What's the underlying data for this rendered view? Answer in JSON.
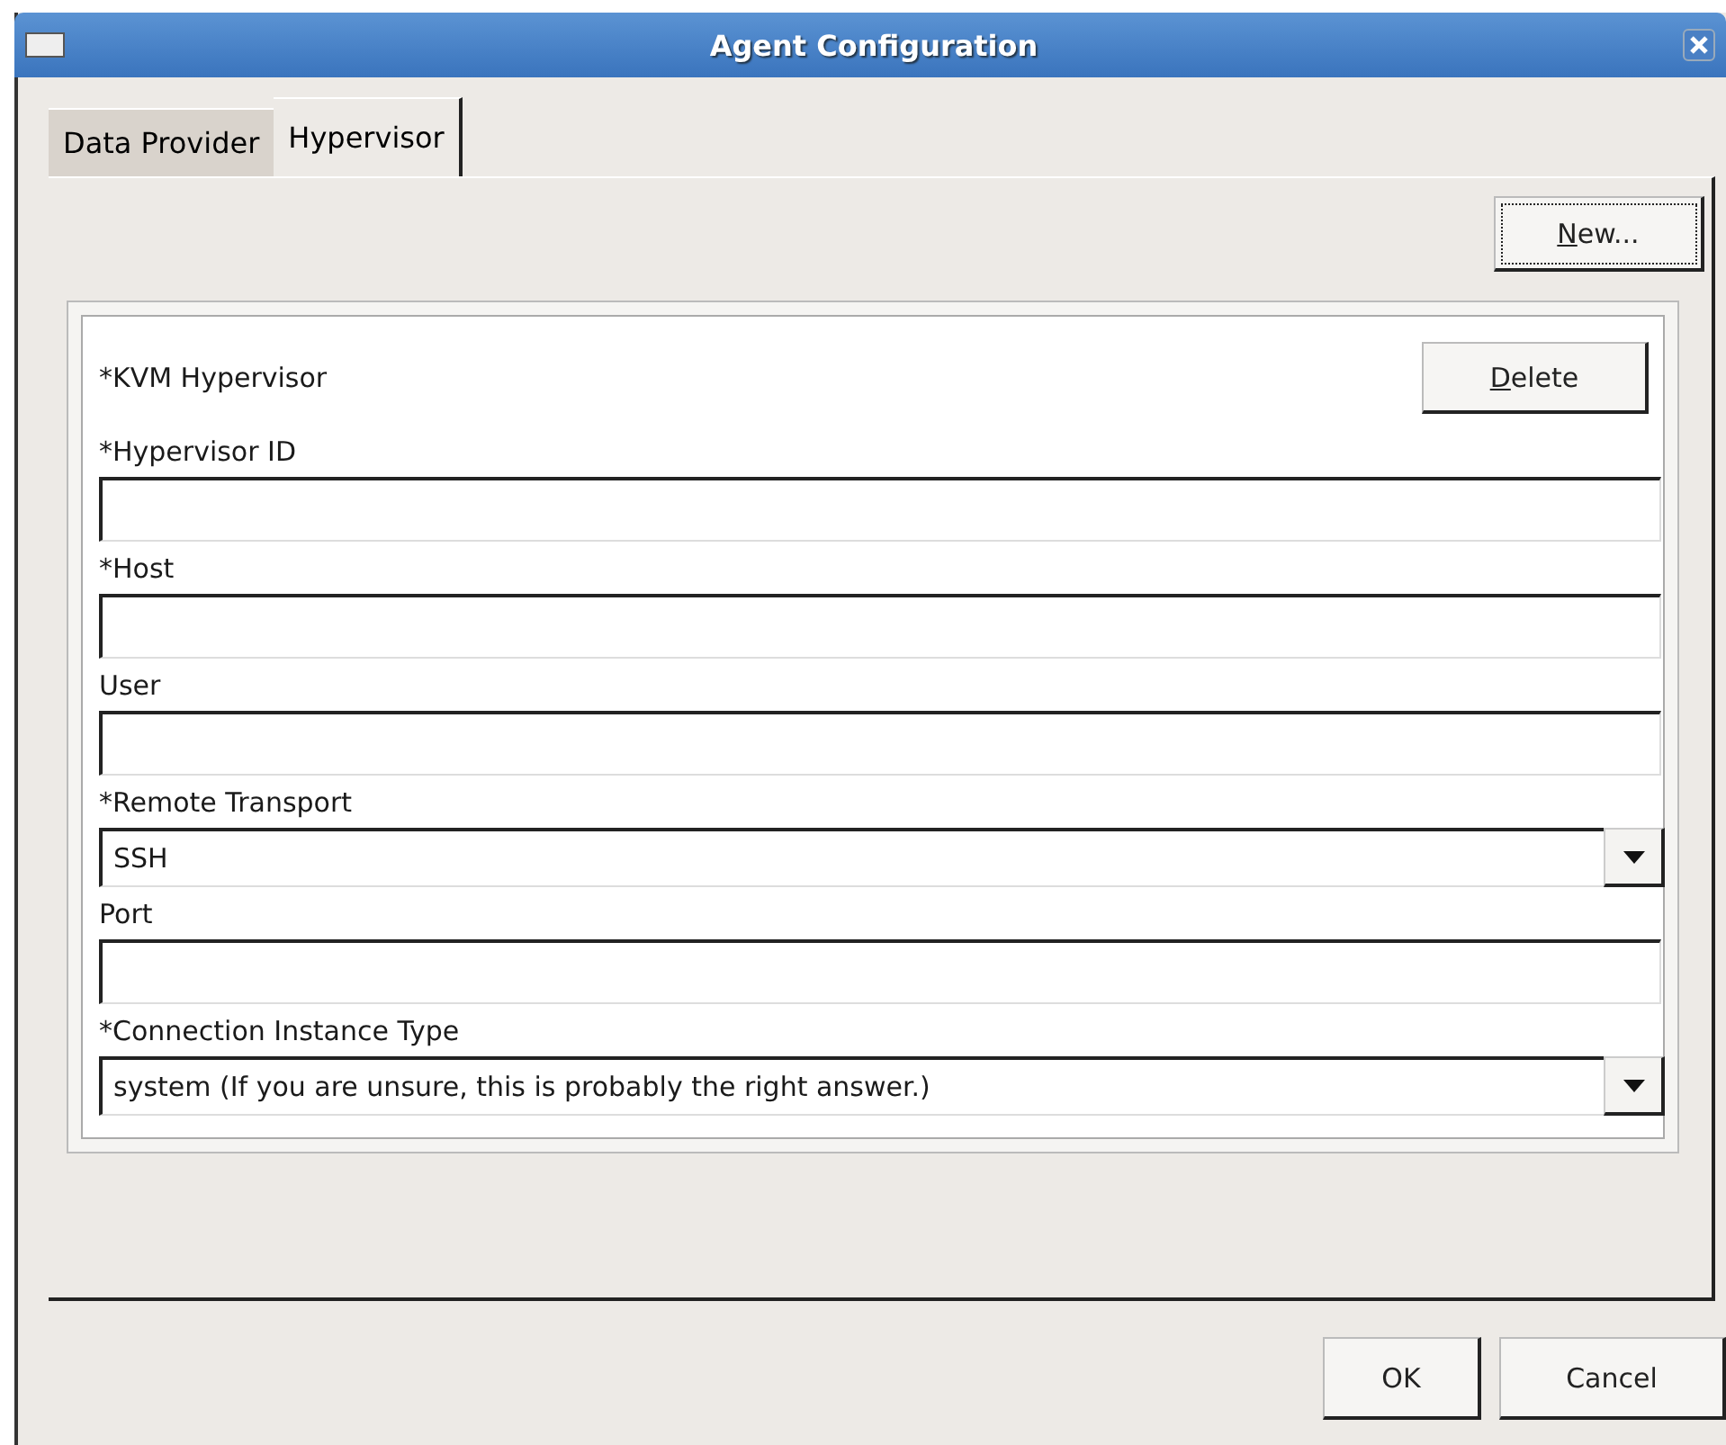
{
  "window": {
    "title": "Agent Configuration"
  },
  "tabs": [
    {
      "label": "Data Provider",
      "selected": false
    },
    {
      "label": "Hypervisor",
      "selected": true
    }
  ],
  "new_button": {
    "label": "New...",
    "underline_first": true,
    "focused": true
  },
  "hypervisor": {
    "title": "*KVM Hypervisor",
    "delete_button": {
      "label": "Delete",
      "underline_first": true,
      "focused": false
    },
    "fields": [
      {
        "kind": "text",
        "label": "*Hypervisor ID"
      },
      {
        "kind": "text",
        "label": "*Host"
      },
      {
        "kind": "text",
        "label": "User"
      },
      {
        "kind": "select",
        "label": "*Remote Transport",
        "value": "SSH"
      },
      {
        "kind": "text",
        "label": "Port"
      },
      {
        "kind": "select",
        "label": "*Connection Instance Type",
        "value": "system (If you are unsure, this is probably the right answer.)"
      }
    ]
  },
  "buttons": [
    {
      "label": "OK"
    },
    {
      "label": "Cancel"
    }
  ]
}
